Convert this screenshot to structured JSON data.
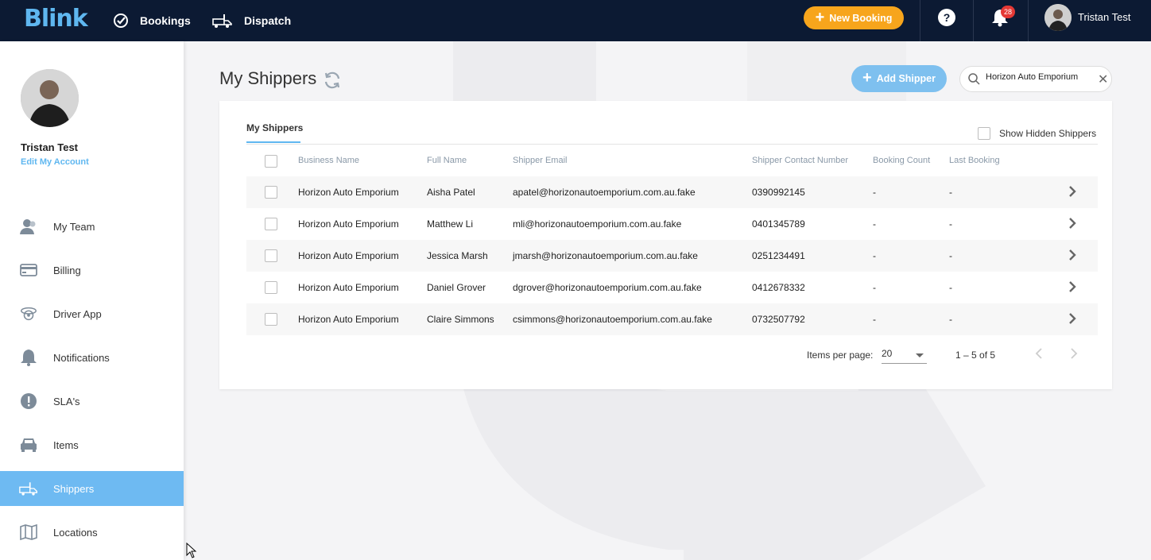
{
  "brand": {
    "logo_text": "Blink"
  },
  "topnav": {
    "items": [
      {
        "label": "Bookings",
        "icon": "check-circle-icon"
      },
      {
        "label": "Dispatch",
        "icon": "truck-icon"
      }
    ],
    "new_booking_label": "New Booking",
    "help_label": "?",
    "notification_count": "28",
    "user_name": "Tristan Test",
    "colors": {
      "bar": "#0c1a33",
      "accent": "#f7a51c",
      "badge": "#e53935"
    }
  },
  "sidebar": {
    "user_name": "Tristan Test",
    "edit_label": "Edit My Account",
    "items": [
      {
        "label": "My Team",
        "icon": "team-icon"
      },
      {
        "label": "Billing",
        "icon": "credit-card-icon"
      },
      {
        "label": "Driver App",
        "icon": "driver-icon"
      },
      {
        "label": "Notifications",
        "icon": "bell-icon"
      },
      {
        "label": "SLA's",
        "icon": "alert-icon"
      },
      {
        "label": "Items",
        "icon": "car-icon"
      },
      {
        "label": "Shippers",
        "icon": "truck-icon",
        "active": true
      },
      {
        "label": "Locations",
        "icon": "map-icon"
      }
    ],
    "active_color": "#6ebaf2"
  },
  "main": {
    "title": "My Shippers",
    "add_label": "Add Shipper",
    "search_value": "Horizon Auto Emporium",
    "tab_label": "My Shippers",
    "show_hidden_label": "Show Hidden Shippers",
    "columns": [
      "Business Name",
      "Full Name",
      "Shipper Email",
      "Shipper Contact Number",
      "Booking Count",
      "Last Booking"
    ],
    "rows": [
      {
        "business": "Horizon Auto Emporium",
        "name": "Aisha Patel",
        "email": "apatel@horizonautoemporium.com.au.fake",
        "phone": "0390992145",
        "count": "-",
        "last": "-"
      },
      {
        "business": "Horizon Auto Emporium",
        "name": "Matthew Li",
        "email": "mli@horizonautoemporium.com.au.fake",
        "phone": "0401345789",
        "count": "-",
        "last": "-"
      },
      {
        "business": "Horizon Auto Emporium",
        "name": "Jessica Marsh",
        "email": "jmarsh@horizonautoemporium.com.au.fake",
        "phone": "0251234491",
        "count": "-",
        "last": "-"
      },
      {
        "business": "Horizon Auto Emporium",
        "name": "Daniel Grover",
        "email": "dgrover@horizonautoemporium.com.au.fake",
        "phone": "0412678332",
        "count": "-",
        "last": "-"
      },
      {
        "business": "Horizon Auto Emporium",
        "name": "Claire Simmons",
        "email": "csimmons@horizonautoemporium.com.au.fake",
        "phone": "0732507792",
        "count": "-",
        "last": "-"
      }
    ],
    "pagination": {
      "items_per_page_label": "Items per page:",
      "items_per_page": "20",
      "range": "1 – 5 of 5"
    }
  }
}
